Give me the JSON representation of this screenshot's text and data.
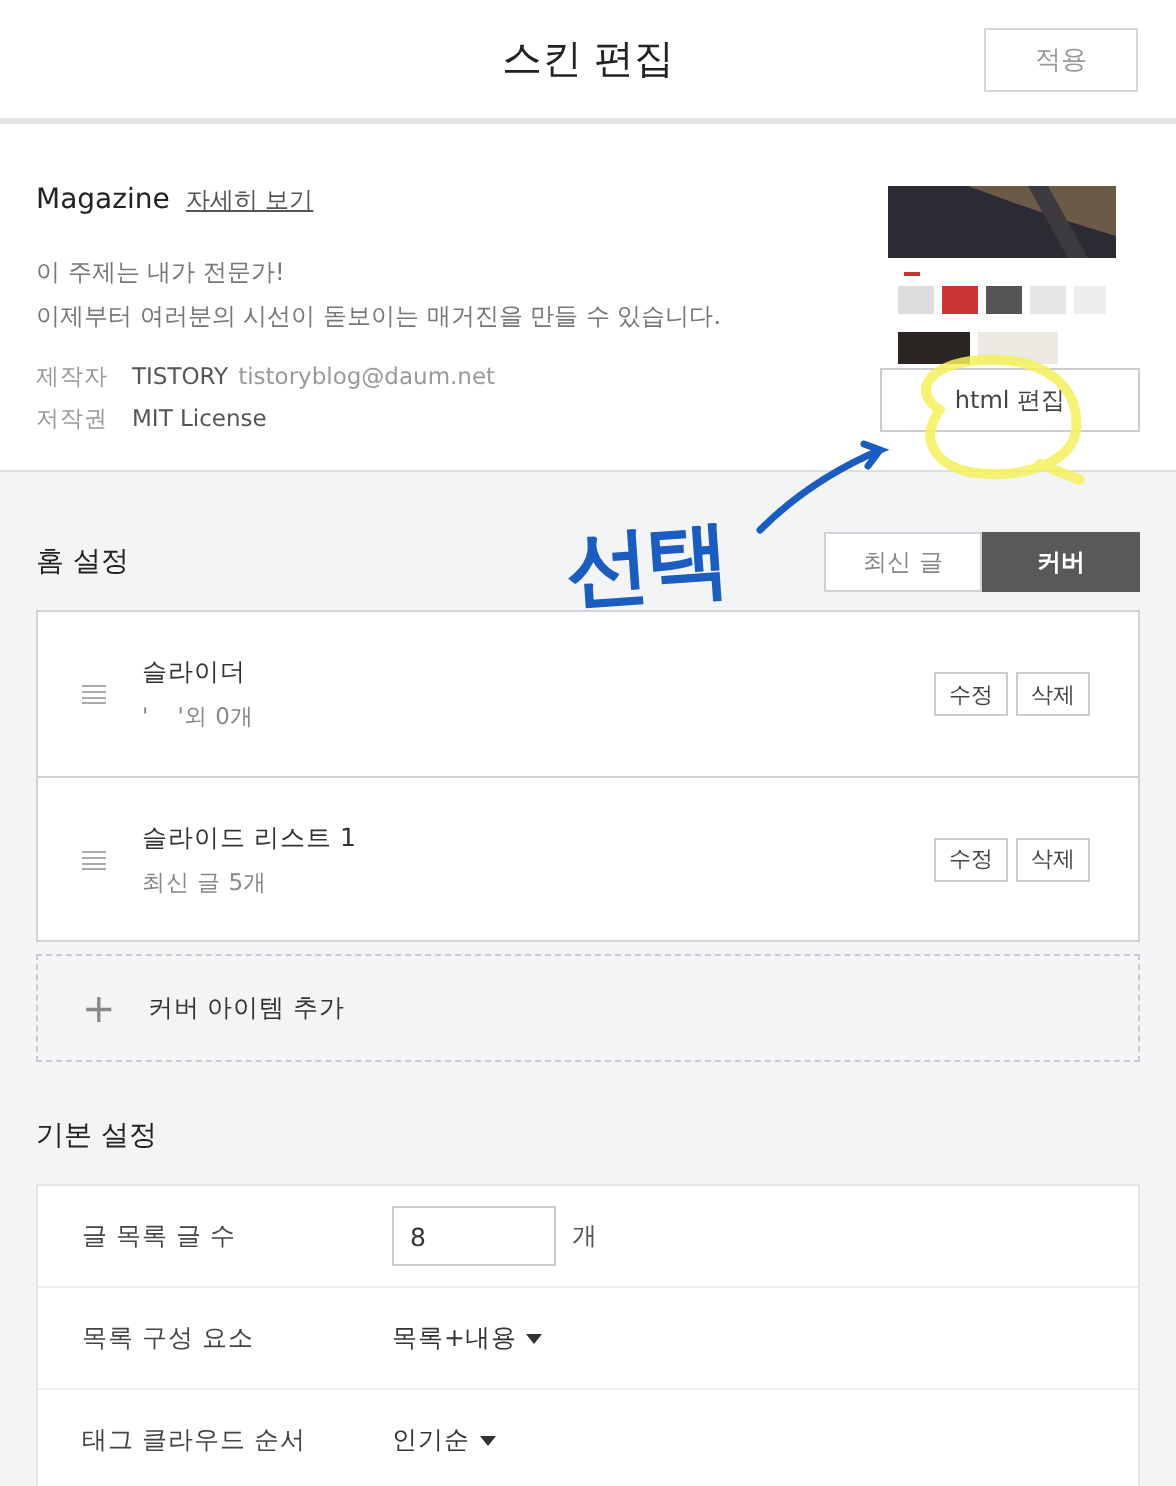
{
  "header": {
    "title": "스킨 편집",
    "apply_button": "적용"
  },
  "skin": {
    "name": "Magazine",
    "details_link": "자세히 보기",
    "description": [
      "이 주제는 내가 전문가!",
      "이제부터 여러분의 시선이 돋보이는 매거진을 만들 수 있습니다."
    ],
    "meta": [
      {
        "label": "제작자",
        "value": "TISTORY",
        "extra": "tistoryblog@daum.net"
      },
      {
        "label": "저작권",
        "value": "MIT License"
      }
    ],
    "preview": {
      "kind": "picture"
    },
    "edit_button": "html 편집"
  },
  "annotation": {
    "text": "선택"
  },
  "home": {
    "title": "홈 설정",
    "tabs": [
      {
        "label": "최신 글",
        "selected": false
      },
      {
        "label": "커버",
        "selected": true
      }
    ],
    "items": [
      {
        "title": "슬라이더",
        "subtitle": "'    '외 0개",
        "edit": "수정",
        "delete": "삭제"
      },
      {
        "title": "슬라이드 리스트 1",
        "subtitle": "최신 글 5개",
        "edit": "수정",
        "delete": "삭제"
      }
    ],
    "add_item": {
      "icon": "+",
      "label": "커버 아이템 추가"
    }
  },
  "basic": {
    "title": "기본 설정",
    "rows": [
      {
        "kind": "number",
        "label": "글 목록 글 수",
        "value": "8",
        "unit": "개"
      },
      {
        "kind": "select",
        "label": "목록 구성 요소",
        "value": "목록+내용"
      },
      {
        "kind": "select",
        "label": "태그 클라우드 순서",
        "value": "인기순"
      }
    ]
  }
}
